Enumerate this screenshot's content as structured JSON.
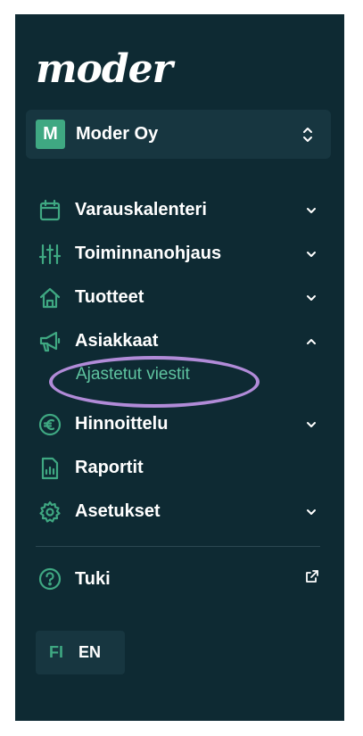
{
  "brand": {
    "logo_text": "moder",
    "accent_color": "#3fa882",
    "submenu_color": "#5fc4a0",
    "sidebar_bg": "#0e2a33",
    "highlight_color": "#b18bd8"
  },
  "org_switcher": {
    "avatar_letter": "M",
    "name": "Moder Oy",
    "icon": "chevron-up-down-icon"
  },
  "nav": {
    "items": [
      {
        "label": "Varauskalenteri",
        "icon": "calendar-icon",
        "chevron": "chevron-down-icon"
      },
      {
        "label": "Toiminnanohjaus",
        "icon": "sliders-icon",
        "chevron": "chevron-down-icon"
      },
      {
        "label": "Tuotteet",
        "icon": "home-icon",
        "chevron": "chevron-down-icon"
      },
      {
        "label": "Asiakkaat",
        "icon": "megaphone-icon",
        "chevron": "chevron-up-icon",
        "expanded": true,
        "subitems": [
          {
            "label": "Ajastetut viestit"
          }
        ]
      },
      {
        "label": "Hinnoittelu",
        "icon": "euro-icon",
        "chevron": "chevron-down-icon"
      },
      {
        "label": "Raportit",
        "icon": "report-icon"
      },
      {
        "label": "Asetukset",
        "icon": "gear-icon",
        "chevron": "chevron-down-icon"
      }
    ]
  },
  "support": {
    "label": "Tuki",
    "icon": "help-circle-icon",
    "external_icon": "external-link-icon"
  },
  "language": {
    "options": [
      "FI",
      "EN"
    ],
    "selected": "FI"
  }
}
